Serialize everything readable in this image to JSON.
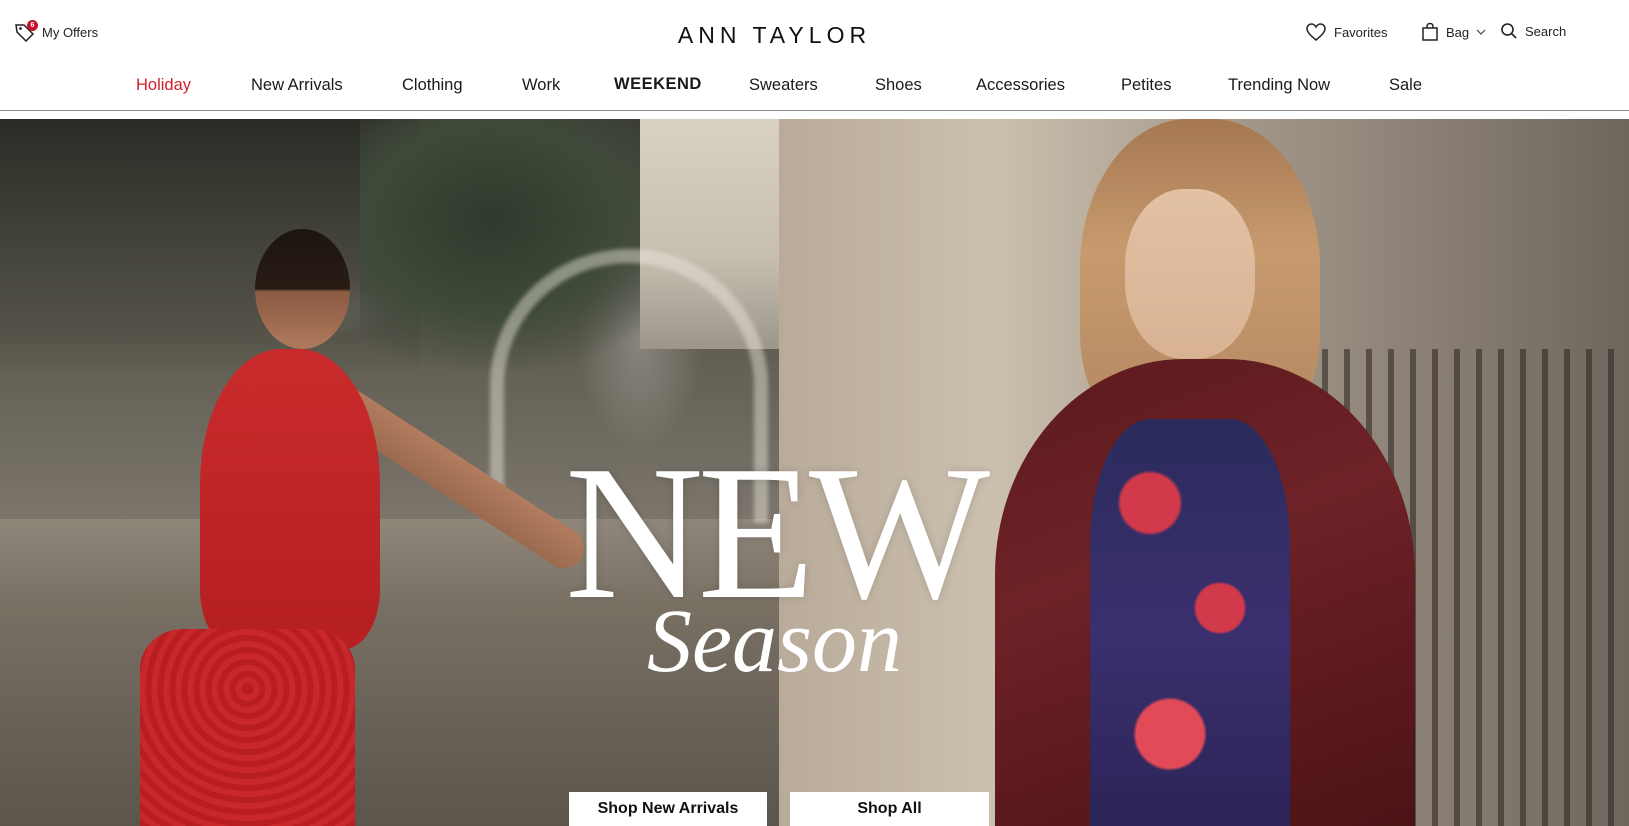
{
  "header": {
    "offers": {
      "label": "My Offers",
      "badge": "6",
      "icon": "tag-icon"
    },
    "logo": "ANN TAYLOR",
    "favorites": {
      "label": "Favorites",
      "icon": "heart-icon"
    },
    "bag": {
      "label": "Bag",
      "icon": "shopping-bag-icon",
      "dropdown_icon": "chevron-down-icon"
    },
    "search": {
      "label": "Search",
      "icon": "search-icon"
    }
  },
  "nav": {
    "items": [
      {
        "label": "Holiday",
        "color": "#d0212a"
      },
      {
        "label": "New Arrivals"
      },
      {
        "label": "Clothing"
      },
      {
        "label": "Work"
      },
      {
        "label": "WEEKEND"
      },
      {
        "label": "Sweaters"
      },
      {
        "label": "Shoes"
      },
      {
        "label": "Accessories"
      },
      {
        "label": "Petites"
      },
      {
        "label": "Trending Now"
      },
      {
        "label": "Sale"
      }
    ]
  },
  "hero": {
    "headline": "NEW",
    "subhead": "Season",
    "buttons": [
      {
        "label": "Shop New Arrivals"
      },
      {
        "label": "Shop All"
      }
    ]
  }
}
